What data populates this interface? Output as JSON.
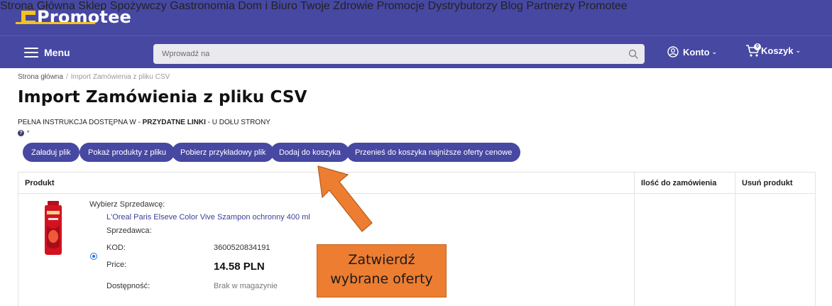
{
  "header": {
    "logo_text": "Promotee",
    "nav": [
      "Strona Główna",
      "Sklep Spożywczy",
      "Gastronomia",
      "Dom i Biuro",
      "Twoje Zdrowie",
      "Promocje",
      "Dystrybutorzy",
      "Blog",
      "Partnerzy Promotee"
    ],
    "menu_label": "Menu",
    "search_placeholder": "Wprowadź na",
    "account_label": "Konto",
    "cart_label": "Koszyk",
    "cart_count": "0"
  },
  "breadcrumb": {
    "home": "Strona główna",
    "separator": "/",
    "current": "Import Zamówienia z pliku CSV"
  },
  "page": {
    "title": "Import Zamówienia z pliku CSV",
    "instruction_prefix": "PEŁNA INSTRUKCJA DOSTĘPNA W - ",
    "instruction_bold": "PRZYDATNE LINKI",
    "instruction_suffix": " - U DOŁU STRONY",
    "help_mark": "*"
  },
  "actions": [
    "Załaduj plik",
    "Pokaż produkty z pliku",
    "Pobierz przykładowy plik",
    "Dodaj do koszyka",
    "Przenieś do koszyka najniższe oferty cenowe"
  ],
  "table": {
    "headers": [
      "Produkt",
      "Ilość do zamówienia",
      "Usuń produkt"
    ],
    "row": {
      "choose_seller": "Wybierz Sprzedawcę:",
      "product_name": "L'Oreal Paris Elseve Color Vive Szampon ochronny 400 ml",
      "seller_label": "Sprzedawca:",
      "code_label": "KOD:",
      "code_value": "3600520834191",
      "price_label": "Price:",
      "price_value": "14.58 PLN",
      "availability_label": "Dostępność:",
      "availability_value": "Brak w magazynie"
    }
  },
  "annotation": {
    "line1": "Zatwierdź",
    "line2": "wybrane oferty"
  },
  "colors": {
    "brand": "#4648a2",
    "logo_accent": "#f4c21c",
    "callout": "#ed7d31"
  }
}
